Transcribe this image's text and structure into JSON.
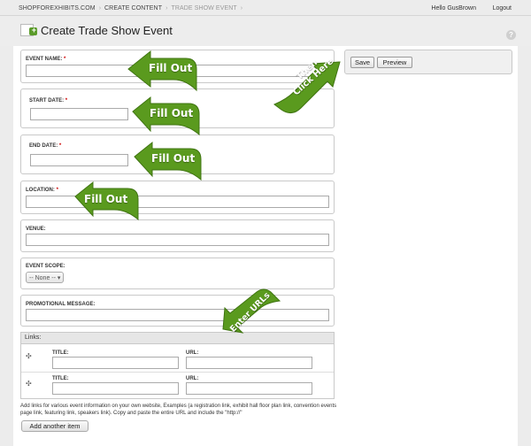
{
  "breadcrumb": {
    "items": [
      "SHOPFOREXHIBITS.COM",
      "CREATE CONTENT",
      "TRADE SHOW EVENT"
    ],
    "separator": "›"
  },
  "user_menu": {
    "greeting": "Hello GusBrown",
    "logout": "Logout"
  },
  "page": {
    "title": "Create Trade Show Event",
    "help": "?"
  },
  "form": {
    "event_name": {
      "label": "EVENT NAME:",
      "required": "*",
      "value": ""
    },
    "start_date": {
      "label": "START DATE:",
      "required": "*",
      "value": ""
    },
    "end_date": {
      "label": "END DATE:",
      "required": "*",
      "value": ""
    },
    "location": {
      "label": "LOCATION:",
      "required": "*",
      "value": ""
    },
    "venue": {
      "label": "VENUE:",
      "value": ""
    },
    "event_scope": {
      "label": "EVENT SCOPE:",
      "selected": "-- None --"
    },
    "promo": {
      "label": "PROMOTIONAL MESSAGE:",
      "value": ""
    },
    "links": {
      "header": "Links:",
      "drag_glyph": "✣",
      "rows": [
        {
          "title_label": "TITLE:",
          "url_label": "URL:",
          "title_value": "",
          "url_value": ""
        },
        {
          "title_label": "TITLE:",
          "url_label": "URL:",
          "title_value": "",
          "url_value": ""
        }
      ],
      "help": "Add links for various event information on your own website, Examples (a registration link, exhibit hall floor plan link, convention events page link, featuring link, speakers link). Copy and paste the entire URL and include the \"http://\"",
      "add_button": "Add another item"
    }
  },
  "actions": {
    "save": "Save",
    "preview": "Preview"
  },
  "callouts": {
    "fill1": "Fill Out",
    "fill2": "Fill Out",
    "fill3": "Fill Out",
    "fill4": "Fill Out",
    "then_line1": "Then",
    "then_line2": "Click Here",
    "enter_urls": "Enter URLs"
  },
  "colors": {
    "callout_green": "#5a9a1e",
    "callout_dark": "#3f7411",
    "required": "#cc0000"
  }
}
